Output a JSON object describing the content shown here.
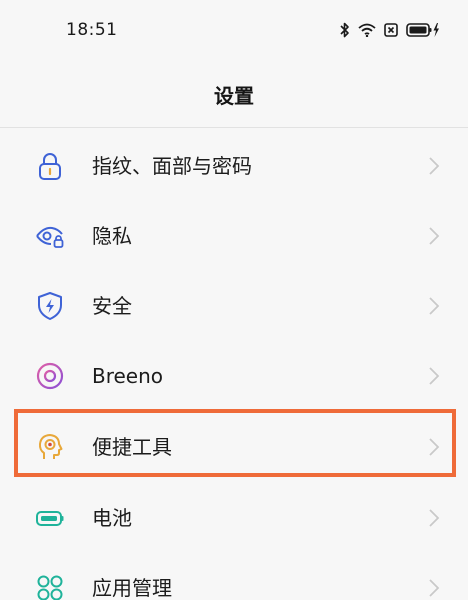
{
  "status_bar": {
    "time": "18:51",
    "icons": [
      "bluetooth-icon",
      "wifi-icon",
      "sim-icon",
      "battery-icon"
    ]
  },
  "header": {
    "title": "设置"
  },
  "settings": {
    "items": [
      {
        "label": "指纹、面部与密码",
        "icon": "lock-icon",
        "color": "#3f63d6"
      },
      {
        "label": "隐私",
        "icon": "eye-lock-icon",
        "color": "#3f63d6"
      },
      {
        "label": "安全",
        "icon": "shield-bolt-icon",
        "color": "#3f63d6"
      },
      {
        "label": "Breeno",
        "icon": "breeno-ring-icon",
        "color": "#c03db5"
      },
      {
        "label": "便捷工具",
        "icon": "head-gear-icon",
        "color": "#e8a83a",
        "highlighted": true
      },
      {
        "label": "电池",
        "icon": "battery-outline-icon",
        "color": "#1fb39a"
      },
      {
        "label": "应用管理",
        "icon": "apps-grid-icon",
        "color": "#1fb39a"
      }
    ]
  },
  "colors": {
    "highlight": "#ef6b39",
    "chevron": "#c9c9c9"
  }
}
